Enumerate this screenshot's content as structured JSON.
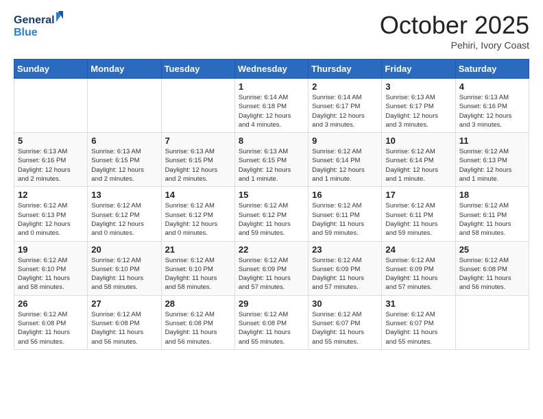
{
  "header": {
    "logo_line1": "General",
    "logo_line2": "Blue",
    "month_title": "October 2025",
    "subtitle": "Pehiri, Ivory Coast"
  },
  "days_of_week": [
    "Sunday",
    "Monday",
    "Tuesday",
    "Wednesday",
    "Thursday",
    "Friday",
    "Saturday"
  ],
  "weeks": [
    [
      {
        "day": "",
        "info": ""
      },
      {
        "day": "",
        "info": ""
      },
      {
        "day": "",
        "info": ""
      },
      {
        "day": "1",
        "info": "Sunrise: 6:14 AM\nSunset: 6:18 PM\nDaylight: 12 hours\nand 4 minutes."
      },
      {
        "day": "2",
        "info": "Sunrise: 6:14 AM\nSunset: 6:17 PM\nDaylight: 12 hours\nand 3 minutes."
      },
      {
        "day": "3",
        "info": "Sunrise: 6:13 AM\nSunset: 6:17 PM\nDaylight: 12 hours\nand 3 minutes."
      },
      {
        "day": "4",
        "info": "Sunrise: 6:13 AM\nSunset: 6:16 PM\nDaylight: 12 hours\nand 3 minutes."
      }
    ],
    [
      {
        "day": "5",
        "info": "Sunrise: 6:13 AM\nSunset: 6:16 PM\nDaylight: 12 hours\nand 2 minutes."
      },
      {
        "day": "6",
        "info": "Sunrise: 6:13 AM\nSunset: 6:15 PM\nDaylight: 12 hours\nand 2 minutes."
      },
      {
        "day": "7",
        "info": "Sunrise: 6:13 AM\nSunset: 6:15 PM\nDaylight: 12 hours\nand 2 minutes."
      },
      {
        "day": "8",
        "info": "Sunrise: 6:13 AM\nSunset: 6:15 PM\nDaylight: 12 hours\nand 1 minute."
      },
      {
        "day": "9",
        "info": "Sunrise: 6:12 AM\nSunset: 6:14 PM\nDaylight: 12 hours\nand 1 minute."
      },
      {
        "day": "10",
        "info": "Sunrise: 6:12 AM\nSunset: 6:14 PM\nDaylight: 12 hours\nand 1 minute."
      },
      {
        "day": "11",
        "info": "Sunrise: 6:12 AM\nSunset: 6:13 PM\nDaylight: 12 hours\nand 1 minute."
      }
    ],
    [
      {
        "day": "12",
        "info": "Sunrise: 6:12 AM\nSunset: 6:13 PM\nDaylight: 12 hours\nand 0 minutes."
      },
      {
        "day": "13",
        "info": "Sunrise: 6:12 AM\nSunset: 6:12 PM\nDaylight: 12 hours\nand 0 minutes."
      },
      {
        "day": "14",
        "info": "Sunrise: 6:12 AM\nSunset: 6:12 PM\nDaylight: 12 hours\nand 0 minutes."
      },
      {
        "day": "15",
        "info": "Sunrise: 6:12 AM\nSunset: 6:12 PM\nDaylight: 11 hours\nand 59 minutes."
      },
      {
        "day": "16",
        "info": "Sunrise: 6:12 AM\nSunset: 6:11 PM\nDaylight: 11 hours\nand 59 minutes."
      },
      {
        "day": "17",
        "info": "Sunrise: 6:12 AM\nSunset: 6:11 PM\nDaylight: 11 hours\nand 59 minutes."
      },
      {
        "day": "18",
        "info": "Sunrise: 6:12 AM\nSunset: 6:11 PM\nDaylight: 11 hours\nand 58 minutes."
      }
    ],
    [
      {
        "day": "19",
        "info": "Sunrise: 6:12 AM\nSunset: 6:10 PM\nDaylight: 11 hours\nand 58 minutes."
      },
      {
        "day": "20",
        "info": "Sunrise: 6:12 AM\nSunset: 6:10 PM\nDaylight: 11 hours\nand 58 minutes."
      },
      {
        "day": "21",
        "info": "Sunrise: 6:12 AM\nSunset: 6:10 PM\nDaylight: 11 hours\nand 58 minutes."
      },
      {
        "day": "22",
        "info": "Sunrise: 6:12 AM\nSunset: 6:09 PM\nDaylight: 11 hours\nand 57 minutes."
      },
      {
        "day": "23",
        "info": "Sunrise: 6:12 AM\nSunset: 6:09 PM\nDaylight: 11 hours\nand 57 minutes."
      },
      {
        "day": "24",
        "info": "Sunrise: 6:12 AM\nSunset: 6:09 PM\nDaylight: 11 hours\nand 57 minutes."
      },
      {
        "day": "25",
        "info": "Sunrise: 6:12 AM\nSunset: 6:08 PM\nDaylight: 11 hours\nand 56 minutes."
      }
    ],
    [
      {
        "day": "26",
        "info": "Sunrise: 6:12 AM\nSunset: 6:08 PM\nDaylight: 11 hours\nand 56 minutes."
      },
      {
        "day": "27",
        "info": "Sunrise: 6:12 AM\nSunset: 6:08 PM\nDaylight: 11 hours\nand 56 minutes."
      },
      {
        "day": "28",
        "info": "Sunrise: 6:12 AM\nSunset: 6:08 PM\nDaylight: 11 hours\nand 56 minutes."
      },
      {
        "day": "29",
        "info": "Sunrise: 6:12 AM\nSunset: 6:08 PM\nDaylight: 11 hours\nand 55 minutes."
      },
      {
        "day": "30",
        "info": "Sunrise: 6:12 AM\nSunset: 6:07 PM\nDaylight: 11 hours\nand 55 minutes."
      },
      {
        "day": "31",
        "info": "Sunrise: 6:12 AM\nSunset: 6:07 PM\nDaylight: 11 hours\nand 55 minutes."
      },
      {
        "day": "",
        "info": ""
      }
    ]
  ]
}
